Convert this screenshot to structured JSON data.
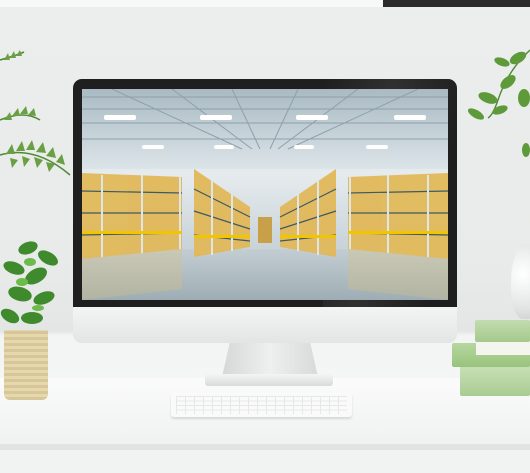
{
  "scene": {
    "subject": "desktop-monitor",
    "screen_content": "warehouse-shelving",
    "colors": {
      "background": "#eceeee",
      "monitor_bezel": "#1f1f20",
      "monitor_body": "#e3e5e5",
      "shelf_accent": "#e2b95a",
      "plant_green": "#5f9a3a",
      "book_green": "#a9cc92",
      "pot_wicker": "#d7c69a"
    },
    "icons": [
      "plant-icon",
      "monitor-icon",
      "keyboard-icon"
    ]
  }
}
